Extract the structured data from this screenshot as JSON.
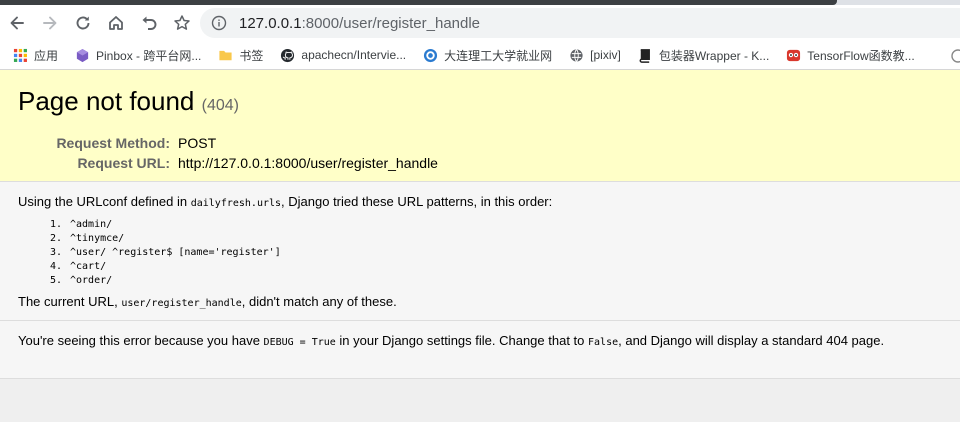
{
  "browser": {
    "address_bar": {
      "url_host": "127.0.0.1",
      "url_rest": ":8000/user/register_handle"
    },
    "bookmarks": [
      {
        "label": "应用",
        "icon": "apps-grid-icon"
      },
      {
        "label": "Pinbox - 跨平台网...",
        "icon": "pinbox-icon"
      },
      {
        "label": "书签",
        "icon": "folder-icon"
      },
      {
        "label": "apachecn/Intervie...",
        "icon": "github-icon"
      },
      {
        "label": "大连理工大学就业网",
        "icon": "university-icon"
      },
      {
        "label": "[pixiv]",
        "icon": "globe-icon"
      },
      {
        "label": "包装器Wrapper - K...",
        "icon": "book-icon"
      },
      {
        "label": "TensorFlow函数教...",
        "icon": "owl-icon"
      }
    ]
  },
  "error_page": {
    "title": "Page not found",
    "status_code": "(404)",
    "request_method_label": "Request Method:",
    "request_method": "POST",
    "request_url_label": "Request URL:",
    "request_url": "http://127.0.0.1:8000/user/register_handle",
    "urlconf_intro_before": "Using the URLconf defined in ",
    "urlconf_module": "dailyfresh.urls",
    "urlconf_intro_after": ", Django tried these URL patterns, in this order:",
    "url_patterns": [
      "^admin/",
      "^tinymce/",
      "^user/ ^register$ [name='register']",
      "^cart/",
      "^order/"
    ],
    "no_match_before": "The current URL, ",
    "no_match_path": "user/register_handle",
    "no_match_after": ", didn't match any of these.",
    "explanation_1": "You're seeing this error because you have ",
    "debug_setting": "DEBUG = True",
    "explanation_2": " in your Django settings file. Change that to ",
    "false_value": "False",
    "explanation_3": ", and Django will display a standard 404 page."
  }
}
